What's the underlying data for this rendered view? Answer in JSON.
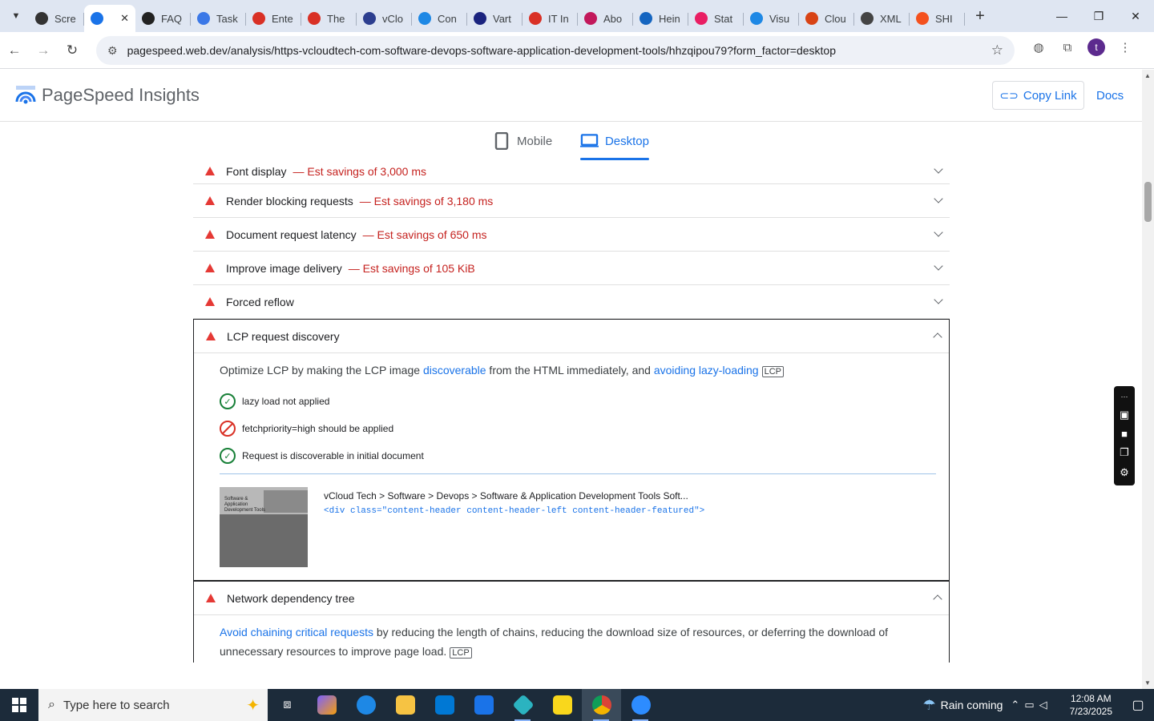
{
  "browser": {
    "tabs": [
      {
        "label": "Scre",
        "color": "#333333"
      },
      {
        "label": "",
        "color": "#1a73e8",
        "active": true
      },
      {
        "label": "FAQ",
        "color": "#222222"
      },
      {
        "label": "Task",
        "color": "#3b78e7"
      },
      {
        "label": "Ente",
        "color": "#d93025"
      },
      {
        "label": "The",
        "color": "#d93025"
      },
      {
        "label": "vClo",
        "color": "#2c3e8f"
      },
      {
        "label": "Con",
        "color": "#1e88e5"
      },
      {
        "label": "Vart",
        "color": "#1a237e"
      },
      {
        "label": "IT In",
        "color": "#d93025"
      },
      {
        "label": "Abo",
        "color": "#c2185b"
      },
      {
        "label": "Hein",
        "color": "#1565c0"
      },
      {
        "label": "Stat",
        "color": "#e91e63"
      },
      {
        "label": "Visu",
        "color": "#1e88e5"
      },
      {
        "label": "Clou",
        "color": "#d84315"
      },
      {
        "label": "XML",
        "color": "#444444"
      },
      {
        "label": "SHI",
        "color": "#f4511e"
      }
    ],
    "close_glyph": "✕",
    "newtab_glyph": "+",
    "url": "pagespeed.web.dev/analysis/https-vcloudtech-com-software-devops-software-application-development-tools/hhzqipou79?form_factor=desktop",
    "avatar_letter": "t"
  },
  "header": {
    "title": "PageSpeed Insights",
    "copy_link": "Copy Link",
    "docs": "Docs"
  },
  "form_tabs": {
    "mobile": "Mobile",
    "desktop": "Desktop"
  },
  "audits": [
    {
      "title": "Font display",
      "savings": "— Est savings of 3,000 ms"
    },
    {
      "title": "Render blocking requests",
      "savings": "— Est savings of 3,180 ms"
    },
    {
      "title": "Document request latency",
      "savings": "— Est savings of 650 ms"
    },
    {
      "title": "Improve image delivery",
      "savings": "— Est savings of 105 KiB"
    },
    {
      "title": "Forced reflow",
      "savings": ""
    }
  ],
  "lcp": {
    "title": "LCP request discovery",
    "desc_1": "Optimize LCP by making the LCP image ",
    "link_1": "discoverable",
    "desc_2": " from the HTML immediately, and ",
    "link_2": "avoiding lazy-loading",
    "tag": "LCP",
    "checks": [
      {
        "text": "lazy load not applied",
        "status": "pass"
      },
      {
        "text": "fetchpriority=high should be applied",
        "status": "fail"
      },
      {
        "text": "Request is discoverable in initial document",
        "status": "pass"
      }
    ],
    "element_path": "vCloud Tech > Software > Devops > Software & Application Development Tools Soft...",
    "element_code": "<div class=\"content-header content-header-left content-header-featured\">",
    "thumb_text": "Software & Application Development Tools"
  },
  "network": {
    "title": "Network dependency tree",
    "link": "Avoid chaining critical requests",
    "desc": " by reducing the length of chains, reducing the download size of resources, or deferring the download of unnecessary resources to improve page load.",
    "tag": "LCP"
  },
  "taskbar": {
    "search_placeholder": "Type here to search",
    "weather": "Rain coming",
    "time": "12:08 AM",
    "date": "7/23/2025"
  }
}
